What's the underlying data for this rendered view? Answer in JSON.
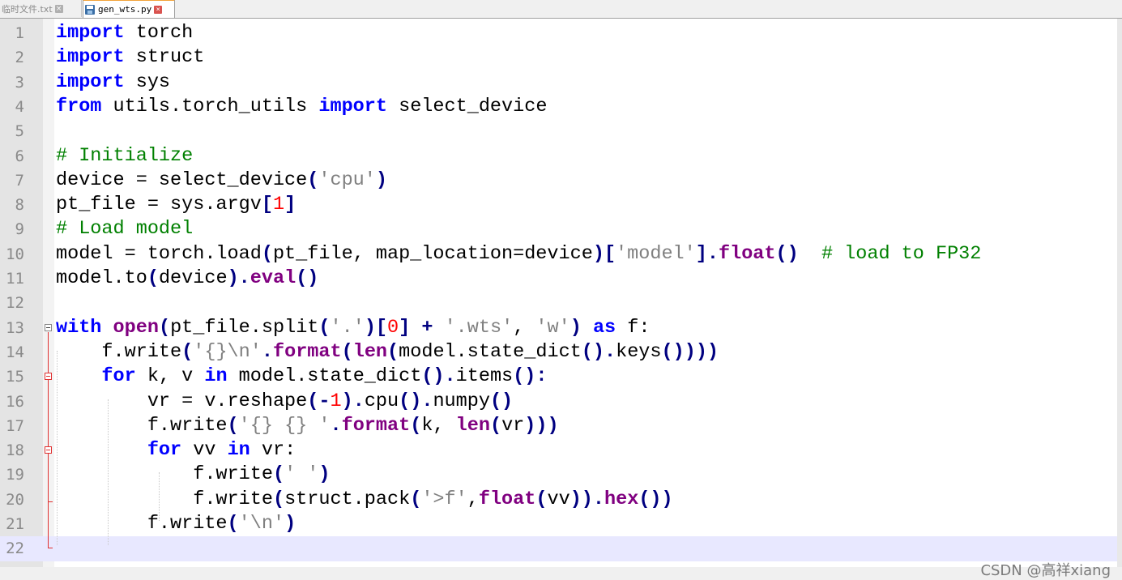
{
  "tabs": [
    {
      "label": "临时文件.txt",
      "active": false
    },
    {
      "label": "gen_wts.py",
      "active": true
    }
  ],
  "icons": {
    "tab_save": "save-icon",
    "tab_close": "close-icon",
    "fold": "fold-collapse-icon"
  },
  "colors": {
    "keyword": "#0000ff",
    "builtin": "#800080",
    "string": "#808080",
    "number": "#ff0000",
    "comment": "#008000",
    "current_line": "#e8e8ff",
    "tab_accent": "#f2a33a"
  },
  "editor": {
    "current_line": 22,
    "lines": [
      {
        "n": "1",
        "t": [
          [
            "kw",
            "import"
          ],
          [
            "",
            " torch"
          ]
        ]
      },
      {
        "n": "2",
        "t": [
          [
            "kw",
            "import"
          ],
          [
            "",
            " struct"
          ]
        ]
      },
      {
        "n": "3",
        "t": [
          [
            "kw",
            "import"
          ],
          [
            "",
            " sys"
          ]
        ]
      },
      {
        "n": "4",
        "t": [
          [
            "kw",
            "from"
          ],
          [
            "",
            " utils.torch_utils "
          ],
          [
            "kw",
            "import"
          ],
          [
            "",
            " select_device"
          ]
        ]
      },
      {
        "n": "5",
        "t": []
      },
      {
        "n": "6",
        "t": [
          [
            "cmt",
            "# Initialize"
          ]
        ]
      },
      {
        "n": "7",
        "t": [
          [
            "",
            "device = select_device"
          ],
          [
            "op",
            "("
          ],
          [
            "str",
            "'cpu'"
          ],
          [
            "op",
            ")"
          ]
        ]
      },
      {
        "n": "8",
        "t": [
          [
            "",
            "pt_file = sys.argv"
          ],
          [
            "op",
            "["
          ],
          [
            "num",
            "1"
          ],
          [
            "op",
            "]"
          ]
        ]
      },
      {
        "n": "9",
        "t": [
          [
            "cmt",
            "# Load model"
          ]
        ]
      },
      {
        "n": "10",
        "t": [
          [
            "",
            "model = torch.load"
          ],
          [
            "op",
            "("
          ],
          [
            "",
            "pt_file, map_location=device"
          ],
          [
            "op",
            ")["
          ],
          [
            "str",
            "'model'"
          ],
          [
            "op",
            "]."
          ],
          [
            "bi",
            "float"
          ],
          [
            "op",
            "()"
          ],
          [
            "",
            "  "
          ],
          [
            "cmt",
            "# load to FP32"
          ]
        ]
      },
      {
        "n": "11",
        "t": [
          [
            "",
            "model.to"
          ],
          [
            "op",
            "("
          ],
          [
            "",
            "device"
          ],
          [
            "op",
            ")."
          ],
          [
            "bi",
            "eval"
          ],
          [
            "op",
            "()"
          ]
        ]
      },
      {
        "n": "12",
        "t": []
      },
      {
        "n": "13",
        "t": [
          [
            "kw",
            "with"
          ],
          [
            "",
            " "
          ],
          [
            "bi",
            "open"
          ],
          [
            "op",
            "("
          ],
          [
            "",
            "pt_file.split"
          ],
          [
            "op",
            "("
          ],
          [
            "str",
            "'.'"
          ],
          [
            "op",
            ")["
          ],
          [
            "num",
            "0"
          ],
          [
            "op",
            "] + "
          ],
          [
            "str",
            "'.wts'"
          ],
          [
            "",
            ", "
          ],
          [
            "str",
            "'w'"
          ],
          [
            "op",
            ")"
          ],
          [
            "",
            " "
          ],
          [
            "kw",
            "as"
          ],
          [
            "",
            " f:"
          ]
        ]
      },
      {
        "n": "14",
        "t": [
          [
            "",
            "    f.write"
          ],
          [
            "op",
            "("
          ],
          [
            "str",
            "'{}\\n'"
          ],
          [
            "op",
            "."
          ],
          [
            "bi",
            "format"
          ],
          [
            "op",
            "("
          ],
          [
            "bi",
            "len"
          ],
          [
            "op",
            "("
          ],
          [
            "",
            "model.state_dict"
          ],
          [
            "op",
            "()."
          ],
          [
            "",
            "keys"
          ],
          [
            "op",
            "())))"
          ]
        ]
      },
      {
        "n": "15",
        "t": [
          [
            "",
            "    "
          ],
          [
            "kw",
            "for"
          ],
          [
            "",
            " k, v "
          ],
          [
            "kw",
            "in"
          ],
          [
            "",
            " model.state_dict"
          ],
          [
            "op",
            "()."
          ],
          [
            "",
            "items"
          ],
          [
            "op",
            "():"
          ]
        ]
      },
      {
        "n": "16",
        "t": [
          [
            "",
            "        vr = v.reshape"
          ],
          [
            "op",
            "(-"
          ],
          [
            "num",
            "1"
          ],
          [
            "op",
            ")."
          ],
          [
            "",
            "cpu"
          ],
          [
            "op",
            "()."
          ],
          [
            "",
            "numpy"
          ],
          [
            "op",
            "()"
          ]
        ]
      },
      {
        "n": "17",
        "t": [
          [
            "",
            "        f.write"
          ],
          [
            "op",
            "("
          ],
          [
            "str",
            "'{} {} '"
          ],
          [
            "op",
            "."
          ],
          [
            "bi",
            "format"
          ],
          [
            "op",
            "("
          ],
          [
            "",
            "k, "
          ],
          [
            "bi",
            "len"
          ],
          [
            "op",
            "("
          ],
          [
            "",
            "vr"
          ],
          [
            "op",
            ")))"
          ]
        ]
      },
      {
        "n": "18",
        "t": [
          [
            "",
            "        "
          ],
          [
            "kw",
            "for"
          ],
          [
            "",
            " vv "
          ],
          [
            "kw",
            "in"
          ],
          [
            "",
            " vr:"
          ]
        ]
      },
      {
        "n": "19",
        "t": [
          [
            "",
            "            f.write"
          ],
          [
            "op",
            "("
          ],
          [
            "str",
            "' '"
          ],
          [
            "op",
            ")"
          ]
        ]
      },
      {
        "n": "20",
        "t": [
          [
            "",
            "            f.write"
          ],
          [
            "op",
            "("
          ],
          [
            "",
            "struct.pack"
          ],
          [
            "op",
            "("
          ],
          [
            "str",
            "'>f'"
          ],
          [
            "",
            ","
          ],
          [
            "bi",
            "float"
          ],
          [
            "op",
            "("
          ],
          [
            "",
            "vv"
          ],
          [
            "op",
            "))."
          ],
          [
            "bi",
            "hex"
          ],
          [
            "op",
            "())"
          ]
        ]
      },
      {
        "n": "21",
        "t": [
          [
            "",
            "        f.write"
          ],
          [
            "op",
            "("
          ],
          [
            "str",
            "'\\n'"
          ],
          [
            "op",
            ")"
          ]
        ]
      },
      {
        "n": "22",
        "t": []
      }
    ]
  },
  "watermark": "CSDN @高祥xiang"
}
